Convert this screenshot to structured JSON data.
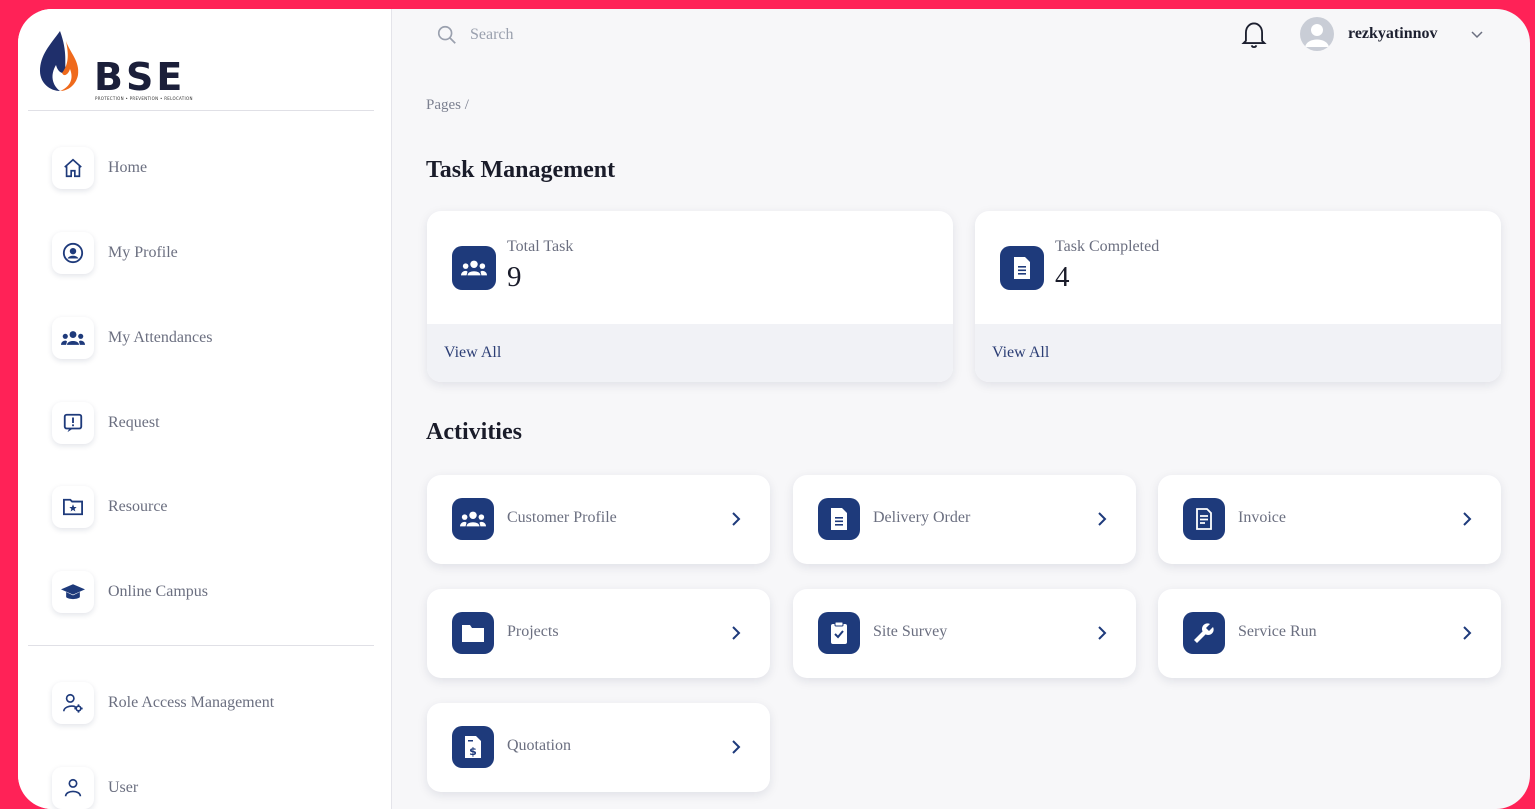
{
  "brand": {
    "name": "BSE",
    "tagline": "PROTECTION • PREVENTION • RELOCATION"
  },
  "sidebar": {
    "items": [
      {
        "label": "Home",
        "icon": "home-icon"
      },
      {
        "label": "My Profile",
        "icon": "user-circle-icon"
      },
      {
        "label": "My Attendances",
        "icon": "users-icon"
      },
      {
        "label": "Request",
        "icon": "alert-message-icon"
      },
      {
        "label": "Resource",
        "icon": "folder-star-icon"
      },
      {
        "label": "Online Campus",
        "icon": "graduation-cap-icon"
      }
    ],
    "admin_items": [
      {
        "label": "Role Access Management",
        "icon": "user-gear-icon"
      },
      {
        "label": "User",
        "icon": "user-icon"
      }
    ]
  },
  "topbar": {
    "search_placeholder": "Search",
    "username": "rezkyatinnov"
  },
  "breadcrumb": "Pages /",
  "main": {
    "title": "Task Management",
    "stats": [
      {
        "label": "Total Task",
        "value": "9",
        "link": "View All",
        "icon": "users-icon"
      },
      {
        "label": "Task Completed",
        "value": "4",
        "link": "View All",
        "icon": "document-icon"
      }
    ],
    "activities_title": "Activities",
    "activities": [
      {
        "label": "Customer Profile",
        "icon": "users-icon"
      },
      {
        "label": "Delivery Order",
        "icon": "document-icon"
      },
      {
        "label": "Invoice",
        "icon": "invoice-icon"
      },
      {
        "label": "Projects",
        "icon": "folder-icon"
      },
      {
        "label": "Site Survey",
        "icon": "clipboard-check-icon"
      },
      {
        "label": "Service Run",
        "icon": "wrench-icon"
      },
      {
        "label": "Quotation",
        "icon": "dollar-document-icon"
      }
    ]
  },
  "colors": {
    "accent": "#1e3a7b",
    "frame": "#ff2257"
  }
}
